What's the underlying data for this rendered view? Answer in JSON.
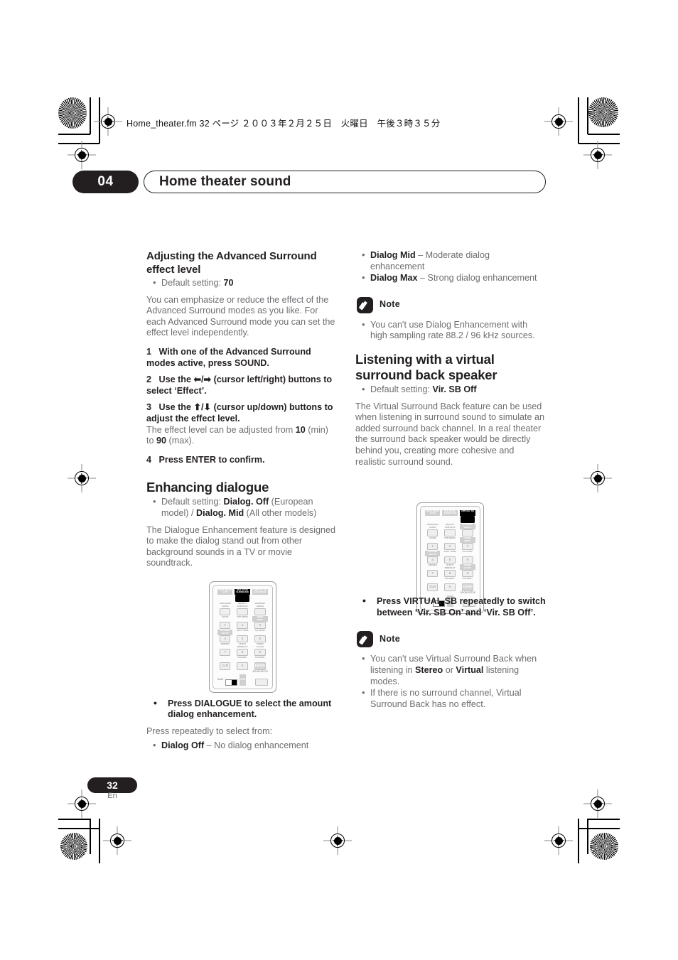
{
  "document_header": "Home_theater.fm  32 ページ  ２００３年２月２５日　火曜日　午後３時３５分",
  "chapter": {
    "number": "04",
    "title": "Home theater sound"
  },
  "footer": {
    "page_number": "32",
    "language": "En"
  },
  "left_column": {
    "section1": {
      "heading": "Adjusting the Advanced Surround effect level",
      "default_setting_label": "Default setting: ",
      "default_setting_value": "70",
      "body": "You can emphasize or reduce the effect of the Advanced Surround modes as you like. For each Advanced Surround mode you can set the effect level independently.",
      "steps": [
        {
          "num": "1",
          "text": "With one of the Advanced Surround modes active, press SOUND."
        },
        {
          "num": "2",
          "text": "Use the ⬅/➡ (cursor left/right) buttons to select ‘Effect’."
        },
        {
          "num": "3",
          "text": "Use the ⬆/⬇ (cursor up/down) buttons to adjust the effect level."
        },
        {
          "num": "4",
          "text": "Press ENTER to confirm."
        }
      ],
      "step3_note_a": "The effect level can be adjusted from ",
      "step3_note_b": "10",
      "step3_note_c": " (min) to ",
      "step3_note_d": "90",
      "step3_note_e": " (max)."
    },
    "section2": {
      "heading": "Enhancing dialogue",
      "default_setting_label": "Default setting: ",
      "default_value_1": "Dialog. Off",
      "default_paren_1": " (European model) / ",
      "default_value_2": "Dialog. Mid",
      "default_paren_2": " (All other models)",
      "body": "The Dialogue Enhancement feature is designed to make the dialog stand out from other background sounds in a TV or movie soundtrack.",
      "instruction": "Press DIALOGUE to select the amount dialog enhancement.",
      "instruction_sub": "Press repeatedly to select from:",
      "option_name": "Dialog Off",
      "option_desc": " – No dialog enhancement"
    },
    "remote": {
      "highlight": "DIALOGUE SURROUND",
      "top_labels": [
        "BASS MODE\nAUTO",
        "DIALOGUE\nSURROUND",
        "VIRTUAL SB\nADVANCED"
      ],
      "row2_labels": [
        "PROGRAM\nAUDIO",
        "REPEAT\nSUBTITLE",
        "RANDOM\nANGLE"
      ],
      "row3_labels": [
        "ZOOM",
        "TOP MENU",
        "HOME\nMENU"
      ],
      "row3_buttons": [
        "1",
        "2",
        "3"
      ],
      "row4_labels": [
        "SYSTEM\nSETUP",
        "TEST TONE",
        "CH LEVEL"
      ],
      "row4_buttons": [
        "4",
        "5",
        "6"
      ],
      "row5_labels": [
        "DIMMER",
        "QUIET/\nMIDNIGHT",
        "TIMER/\nCLOCK"
      ],
      "row5_buttons": [
        "7",
        "8",
        "9"
      ],
      "row6_labels": [
        "",
        "FOLDER–",
        "FOLDER+"
      ],
      "row6_buttons": [
        "CLR",
        "0",
        "ENTER"
      ],
      "switch_labels": [
        "MAIN",
        "SUB"
      ],
      "room_setup_label": "ROOM SETUP"
    }
  },
  "right_column": {
    "options": [
      {
        "name": "Dialog Mid",
        "desc": " – Moderate dialog enhancement"
      },
      {
        "name": "Dialog Max",
        "desc": " – Strong dialog enhancement"
      }
    ],
    "note1": {
      "label": "Note",
      "items": [
        "You can't use Dialog Enhancement with high sampling rate 88.2 / 96 kHz sources."
      ]
    },
    "section": {
      "heading": "Listening with a virtual surround back speaker",
      "default_setting_label": "Default setting: ",
      "default_setting_value": "Vir. SB Off",
      "body": "The Virtual Surround Back feature can be used when listening in surround sound to simulate an added surround back channel. In a real theater the surround back speaker would be directly behind you, creating more cohesive and realistic surround sound.",
      "instruction": "Press VIRTUAL SB repeatedly to switch between ‘Vir. SB On’ and ‘Vir. SB Off’."
    },
    "note2": {
      "label": "Note",
      "items_rich": [
        {
          "a": "You can't use Virtual Surround Back when listening in ",
          "b": "Stereo",
          "c": " or ",
          "d": "Virtual",
          "e": " listening modes."
        }
      ],
      "items": [
        "If there is no surround channel, Virtual Surround Back has no effect."
      ]
    },
    "remote": {
      "highlight": "VIRTUAL SB",
      "top_labels": [
        "BASS MODE\nAUTO",
        "DIALOGUE\nSURROUND",
        "VIRTUAL SB"
      ],
      "row2_labels": [
        "PROGRAM\nAUDIO",
        "REPEAT\nSUBTITLE",
        "RANDOM\nANGLE"
      ],
      "row3_labels": [
        "ZOOM",
        "TOP MENU",
        "HOME\nMENU"
      ],
      "row3_buttons": [
        "1",
        "2",
        "3"
      ],
      "row4_labels": [
        "SYSTEM\nSETUP",
        "TEST TONE",
        "CH LEVEL"
      ],
      "row4_buttons": [
        "4",
        "5",
        "6"
      ],
      "row5_labels": [
        "DIMMER",
        "QUIET/\nMIDNIGHT",
        "TIMER/\nCLOCK"
      ],
      "row5_buttons": [
        "7",
        "8",
        "9"
      ],
      "row6_labels": [
        "",
        "FOLDER–",
        "FOLDER+"
      ],
      "row6_buttons": [
        "CLR",
        "0",
        "ENTER"
      ],
      "switch_labels": [
        "MAIN",
        "SUB"
      ],
      "room_setup_label": "ROOM SETUP"
    }
  },
  "colors": {
    "ink": "#231f20",
    "body_gray": "#6d6e71",
    "remote_gray": "#9d9d9d"
  }
}
